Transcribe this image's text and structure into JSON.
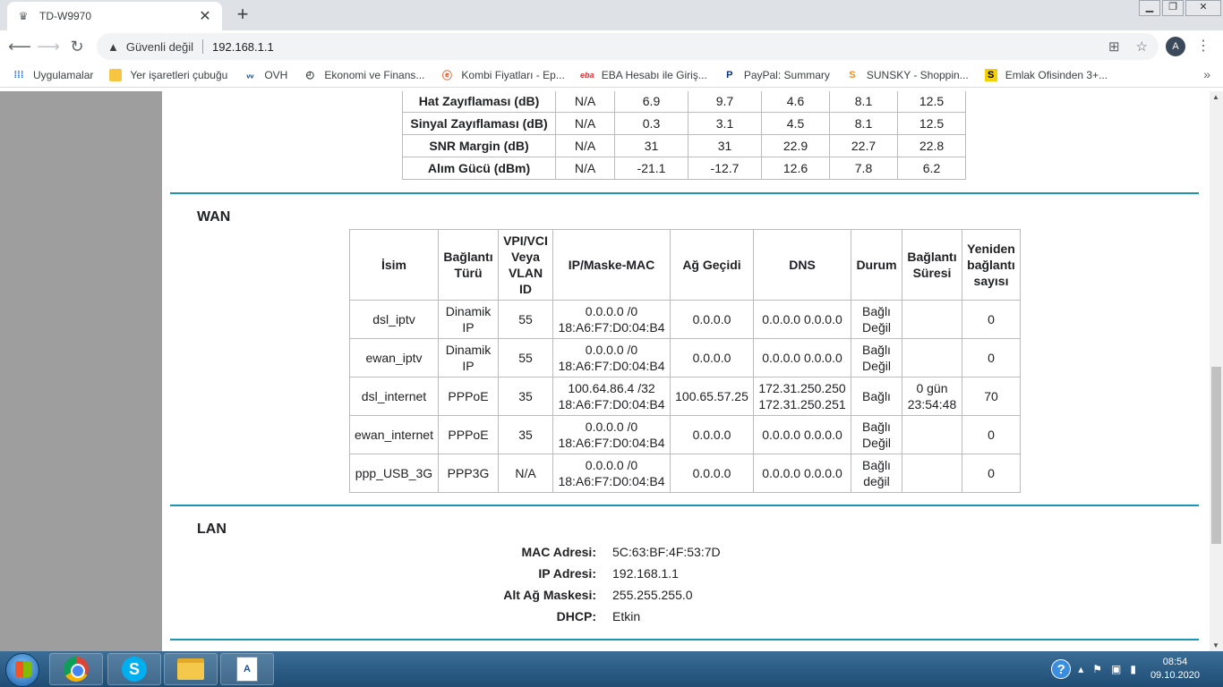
{
  "browser": {
    "tab_title": "TD-W9970",
    "security_label": "Güvenli değil",
    "url": "192.168.1.1",
    "avatar_initials": "A"
  },
  "bookmarks": [
    {
      "label": "Uygulamalar",
      "icon": "apps-icon",
      "color": "#1a73e8"
    },
    {
      "label": "Yer işaretleri çubuğu",
      "icon": "folder-icon",
      "color": "#f6c642"
    },
    {
      "label": "OVH",
      "icon": "ovh-icon",
      "color": "#123f6d"
    },
    {
      "label": "Ekonomi ve Finans...",
      "icon": "clock-icon",
      "color": "#202124"
    },
    {
      "label": "Kombi Fiyatları - Ep...",
      "icon": "e-icon",
      "color": "#e25b2a"
    },
    {
      "label": "EBA Hesabı ile Giriş...",
      "icon": "eba-icon",
      "color": "#d33"
    },
    {
      "label": "PayPal: Summary",
      "icon": "paypal-icon",
      "color": "#003087"
    },
    {
      "label": "SUNSKY - Shoppin...",
      "icon": "sunsky-icon",
      "color": "#f28c1b"
    },
    {
      "label": "Emlak Ofisinden 3+...",
      "icon": "s-icon",
      "color": "#f5d000"
    }
  ],
  "adsl_rows": [
    {
      "label": "Hat Zayıflaması (dB)",
      "values": [
        "N/A",
        "6.9",
        "9.7",
        "4.6",
        "8.1",
        "12.5"
      ]
    },
    {
      "label": "Sinyal Zayıflaması (dB)",
      "values": [
        "N/A",
        "0.3",
        "3.1",
        "4.5",
        "8.1",
        "12.5"
      ]
    },
    {
      "label": "SNR Margin (dB)",
      "values": [
        "N/A",
        "31",
        "31",
        "22.9",
        "22.7",
        "22.8"
      ]
    },
    {
      "label": "Alım Gücü (dBm)",
      "values": [
        "N/A",
        "-21.1",
        "-12.7",
        "12.6",
        "7.8",
        "6.2"
      ]
    }
  ],
  "wan": {
    "title": "WAN",
    "headers": [
      "İsim",
      "Bağlantı Türü",
      "VPI/VCI Veya VLAN ID",
      "IP/Maske-MAC",
      "Ağ Geçidi",
      "DNS",
      "Durum",
      "Bağlantı Süresi",
      "Yeniden bağlantı sayısı"
    ],
    "rows": [
      {
        "name": "dsl_iptv",
        "type": "Dinamik IP",
        "vlan": "55",
        "ip": "0.0.0.0 /0",
        "mac": "18:A6:F7:D0:04:B4",
        "gateway": "0.0.0.0",
        "dns1": "0.0.0.0 0.0.0.0",
        "dns2": "",
        "status": "Bağlı Değil",
        "uptime": "",
        "reconnects": "0"
      },
      {
        "name": "ewan_iptv",
        "type": "Dinamik IP",
        "vlan": "55",
        "ip": "0.0.0.0 /0",
        "mac": "18:A6:F7:D0:04:B4",
        "gateway": "0.0.0.0",
        "dns1": "0.0.0.0 0.0.0.0",
        "dns2": "",
        "status": "Bağlı Değil",
        "uptime": "",
        "reconnects": "0"
      },
      {
        "name": "dsl_internet",
        "type": "PPPoE",
        "vlan": "35",
        "ip": "100.64.86.4 /32",
        "mac": "18:A6:F7:D0:04:B4",
        "gateway": "100.65.57.25",
        "dns1": "172.31.250.250",
        "dns2": "172.31.250.251",
        "status": "Bağlı",
        "uptime": "0 gün 23:54:48",
        "reconnects": "70"
      },
      {
        "name": "ewan_internet",
        "type": "PPPoE",
        "vlan": "35",
        "ip": "0.0.0.0 /0",
        "mac": "18:A6:F7:D0:04:B4",
        "gateway": "0.0.0.0",
        "dns1": "0.0.0.0 0.0.0.0",
        "dns2": "",
        "status": "Bağlı Değil",
        "uptime": "",
        "reconnects": "0"
      },
      {
        "name": "ppp_USB_3G",
        "type": "PPP3G",
        "vlan": "N/A",
        "ip": "0.0.0.0 /0",
        "mac": "18:A6:F7:D0:04:B4",
        "gateway": "0.0.0.0",
        "dns1": "0.0.0.0 0.0.0.0",
        "dns2": "",
        "status": "Bağlı değil",
        "uptime": "",
        "reconnects": "0"
      }
    ]
  },
  "lan": {
    "title": "LAN",
    "fields": [
      {
        "label": "MAC Adresi:",
        "value": "5C:63:BF:4F:53:7D"
      },
      {
        "label": "IP Adresi:",
        "value": "192.168.1.1"
      },
      {
        "label": "Alt Ağ Maskesi:",
        "value": "255.255.255.0"
      },
      {
        "label": "DHCP:",
        "value": "Etkin"
      }
    ]
  },
  "taskbar": {
    "time": "08:54",
    "date": "09.10.2020"
  },
  "colors": {
    "section_rule": "#1b95b2",
    "page_background": "#9e9e9e"
  }
}
